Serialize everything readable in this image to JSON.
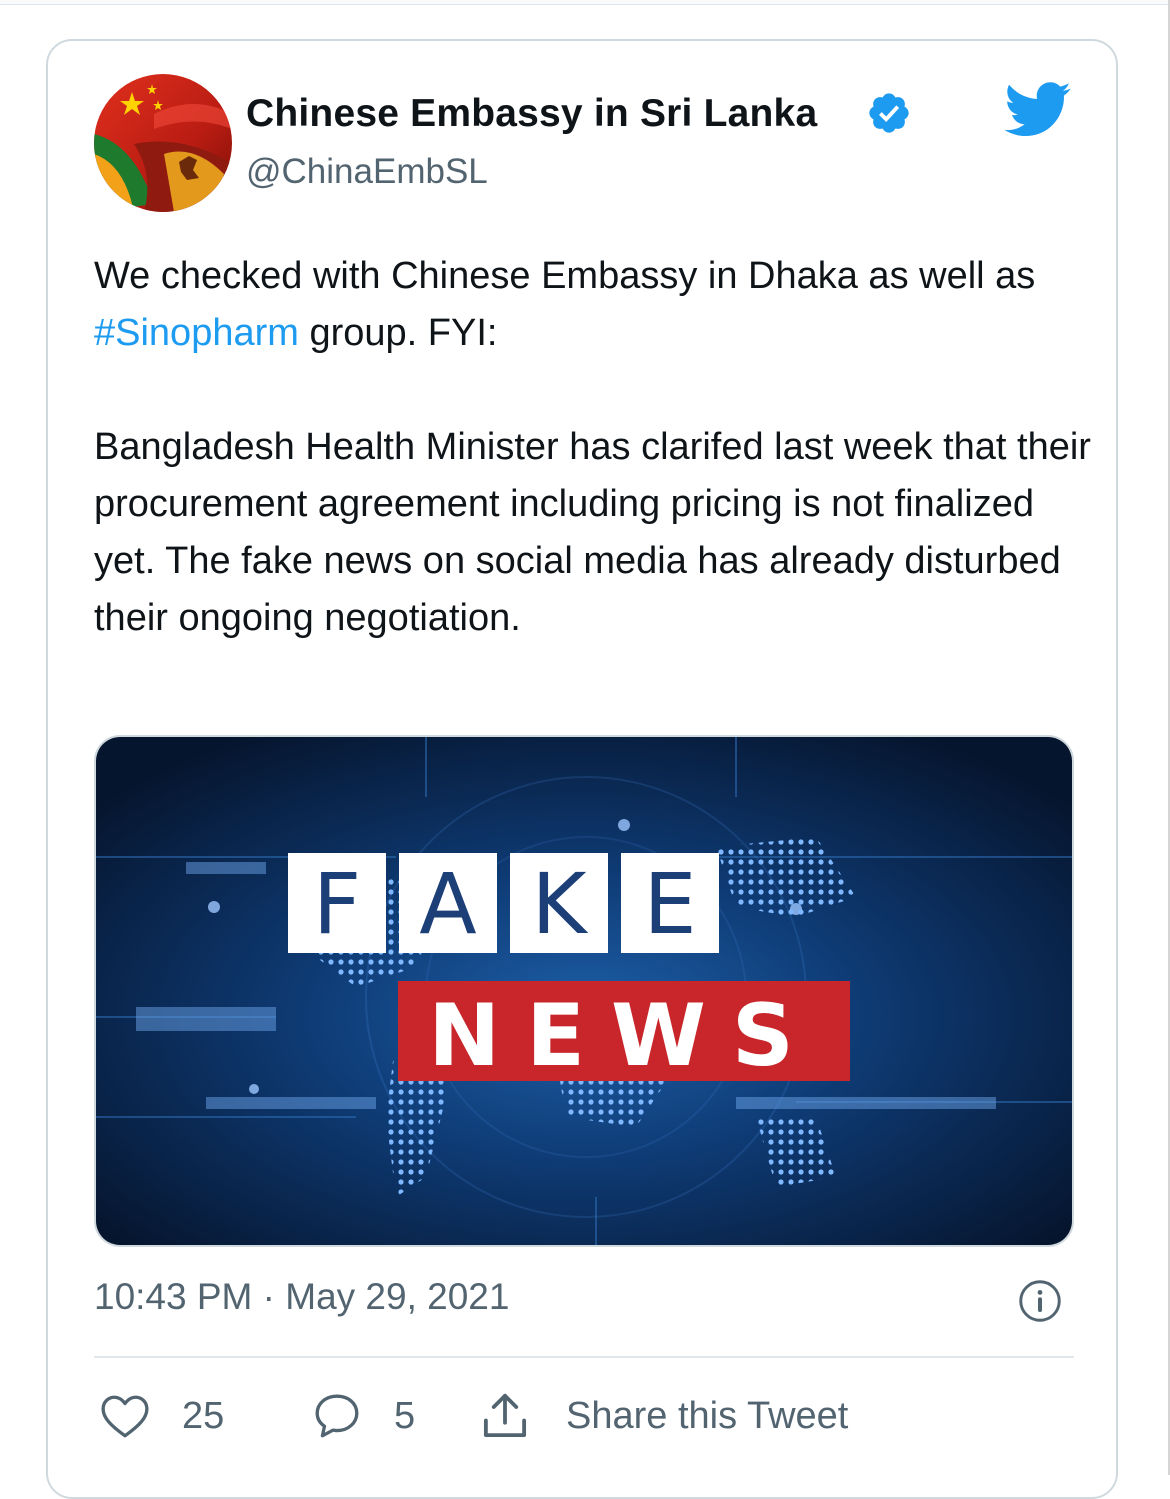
{
  "tweet": {
    "display_name": "Chinese Embassy in Sri Lanka",
    "handle": "@ChinaEmbSL",
    "verified": true,
    "text_paragraph_1_before": "We checked with Chinese Embassy in Dhaka as well as ",
    "hashtag": "#Sinopharm",
    "text_paragraph_1_after": " group. FYI:",
    "text_paragraph_2": "Bangladesh Health Minister has clarifed last week that their procurement agreement including pricing is not finalized yet. The fake news on social media has already disturbed their ongoing negotiation.",
    "timestamp": "10:43 PM · May 29, 2021"
  },
  "media": {
    "fake_letters": [
      "F",
      "A",
      "K",
      "E"
    ],
    "news_text": "NEWS"
  },
  "actions": {
    "like_count": "25",
    "reply_count": "5",
    "share_label": "Share this Tweet"
  },
  "icons": {
    "verified": "verified-badge-icon",
    "brand": "twitter-bird-icon",
    "info": "info-icon",
    "like": "heart-icon",
    "reply": "speech-bubble-icon",
    "share": "share-upload-icon"
  },
  "colors": {
    "accent": "#1d9bf0",
    "text_primary": "#0f1419",
    "text_secondary": "#536471",
    "border": "#cfd9de",
    "news_red": "#c8262b"
  }
}
